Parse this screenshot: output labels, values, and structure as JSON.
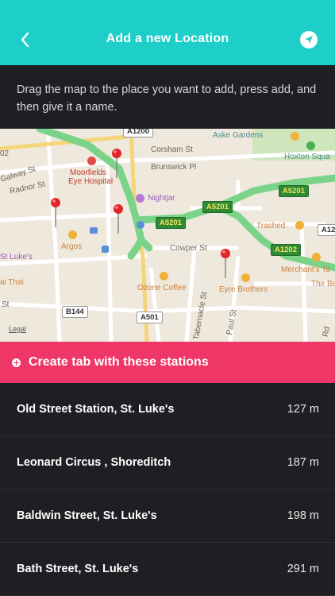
{
  "header": {
    "title": "Add a new Location",
    "background": "#1ecfc9"
  },
  "instructions": {
    "text": "Drag the map to the place you want to add, press add, and then give it a name."
  },
  "map": {
    "labels": {
      "corsham_st": "Corsham St",
      "brunswick_pl": "Brunswick Pl",
      "moorfields": "Moorfields",
      "eye_hospital": "Eye Hospital",
      "nightjar": "Nightjar",
      "galway_st": "Galway St",
      "radnor_st": "Radnor St",
      "argos": "Argos",
      "st_lukes": "St Luke's",
      "thai": "ai Thai",
      "cowper_st": "Cowper St",
      "ozone_coffee": "Ozone Coffee",
      "eyre_brothers": "Eyre Brothers",
      "tabernacle_st": "Tabernacle St",
      "paul_st": "Paul St",
      "aske_gardens": "Aske Gardens",
      "hoxton_square": "Hoxton Squa",
      "trashed": "Trashed",
      "merchants": "Merchant's Ta",
      "the_be": "The Be",
      "st": "St",
      "rd": "Rd",
      "o2": "02"
    },
    "roads": {
      "a1200": "A1200",
      "a5201_a": "A5201",
      "a5201_b": "A5201",
      "a5201_c": "A5201",
      "a1202": "A1202",
      "a12": "A12",
      "b144": "B144",
      "a501": "A501"
    },
    "legal": "Legal"
  },
  "create_tab": {
    "label": "Create tab with these stations",
    "color": "#ee3667"
  },
  "stations": [
    {
      "name": "Old Street Station, St. Luke's",
      "distance": "127 m"
    },
    {
      "name": "Leonard Circus , Shoreditch",
      "distance": "187 m"
    },
    {
      "name": "Baldwin Street, St. Luke's",
      "distance": "198 m"
    },
    {
      "name": "Bath Street, St. Luke's",
      "distance": "291 m"
    }
  ]
}
